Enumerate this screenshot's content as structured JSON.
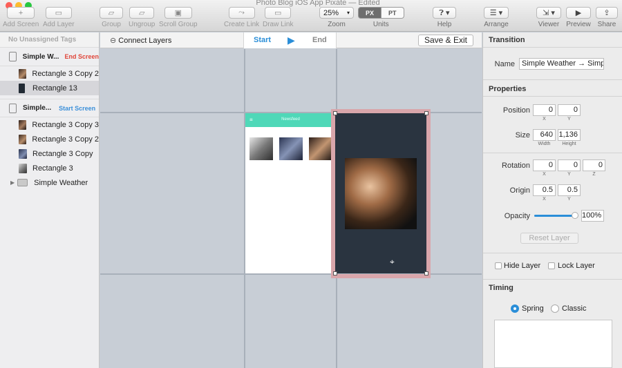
{
  "window": {
    "title": "Photo Blog iOS App Pixate — Edited"
  },
  "toolbar": {
    "add_screen": "Add Screen",
    "add_layer": "Add Layer",
    "group": "Group",
    "ungroup": "Ungroup",
    "scroll_group": "Scroll Group",
    "create_link": "Create Link",
    "draw_link": "Draw Link",
    "zoom_value": "25%",
    "zoom_label": "Zoom",
    "units_px": "PX",
    "units_pt": "PT",
    "units_label": "Units",
    "help": "Help",
    "arrange": "Arrange",
    "viewer": "Viewer",
    "preview": "Preview",
    "share": "Share"
  },
  "left_panel": {
    "tags_header": "No Unassigned Tags",
    "screens": [
      {
        "name": "Simple W...",
        "tag": "End Screen",
        "layers": [
          "Rectangle 3 Copy 2",
          "Rectangle 13"
        ]
      },
      {
        "name": "Simple...",
        "tag": "Start Screen",
        "layers": [
          "Rectangle 3 Copy 3",
          "Rectangle 3 Copy 2",
          "Rectangle 3 Copy",
          "Rectangle 3"
        ],
        "group": "Simple Weather"
      }
    ]
  },
  "canvas": {
    "connect_layers": "Connect Layers",
    "start": "Start",
    "end": "End",
    "save_exit": "Save & Exit",
    "phone_header": "Newsfeed"
  },
  "inspector": {
    "transition_header": "Transition",
    "name_label": "Name",
    "name_value": "Simple Weather → Simp",
    "properties_header": "Properties",
    "position_label": "Position",
    "position_x": "0",
    "position_y": "0",
    "size_label": "Size",
    "size_w": "640",
    "size_h": "1,136",
    "width_sub": "Width",
    "height_sub": "Height",
    "rotation_label": "Rotation",
    "rotation_x": "0",
    "rotation_y": "0",
    "rotation_z": "0",
    "origin_label": "Origin",
    "origin_x": "0.5",
    "origin_y": "0.5",
    "sub_x": "X",
    "sub_y": "Y",
    "sub_z": "Z",
    "opacity_label": "Opacity",
    "opacity_value": "100%",
    "opacity_fraction": 1.0,
    "reset_layer": "Reset Layer",
    "hide_layer": "Hide Layer",
    "lock_layer": "Lock Layer",
    "timing_header": "Timing",
    "spring": "Spring",
    "classic": "Classic",
    "selected_timing": "Spring"
  },
  "colors": {
    "accent_blue": "#2a8ed8",
    "end_red": "#e0463a",
    "teal": "#4fd8b8",
    "dark_screen": "#2a3440",
    "selection_pink": "#d9a6ab"
  }
}
